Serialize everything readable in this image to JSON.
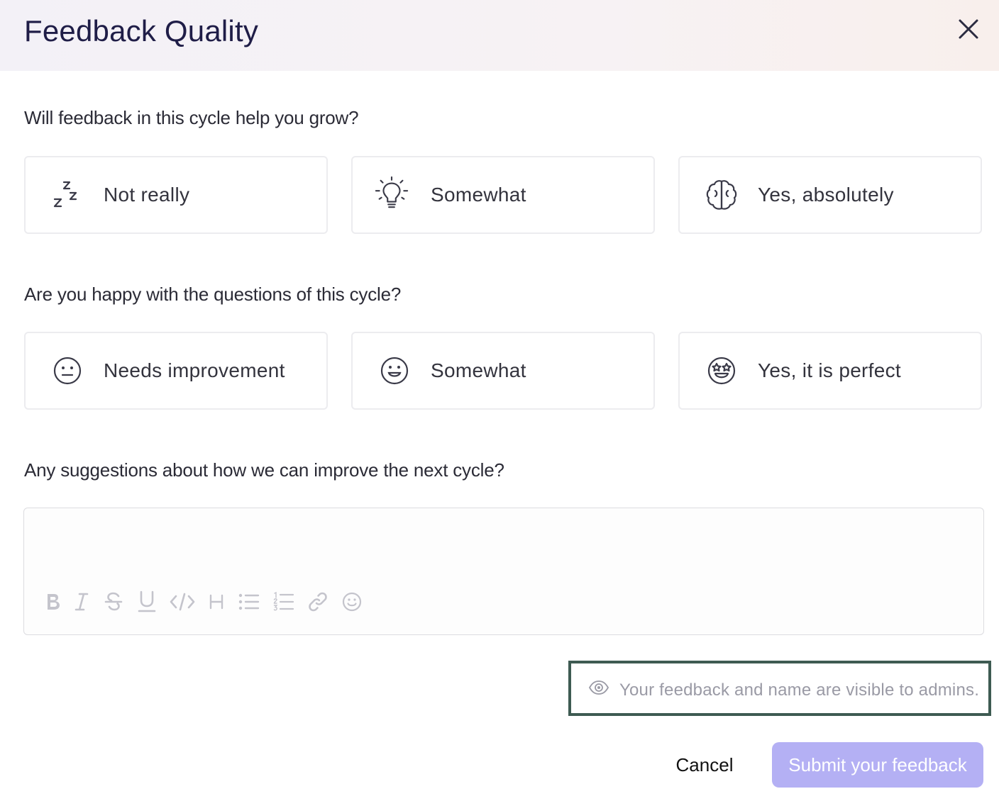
{
  "dialog": {
    "title": "Feedback Quality",
    "close_icon": "close-icon"
  },
  "q1": {
    "question": "Will feedback in this cycle help you grow?",
    "options": [
      {
        "label": "Not really",
        "icon": "sleep-zzz-icon"
      },
      {
        "label": "Somewhat",
        "icon": "lightbulb-icon"
      },
      {
        "label": "Yes, absolutely",
        "icon": "brain-icon"
      }
    ]
  },
  "q2": {
    "question": "Are you happy with the questions of this cycle?",
    "options": [
      {
        "label": "Needs improvement",
        "icon": "neutral-face-icon"
      },
      {
        "label": "Somewhat",
        "icon": "smiling-face-icon"
      },
      {
        "label": "Yes, it is perfect",
        "icon": "star-struck-face-icon"
      }
    ]
  },
  "q3": {
    "question": "Any suggestions about how we can improve the next cycle?",
    "value": "",
    "toolbar": [
      "bold-icon",
      "italic-icon",
      "strikethrough-icon",
      "underline-icon",
      "code-icon",
      "heading-icon",
      "bullet-list-icon",
      "numbered-list-icon",
      "link-icon",
      "emoji-icon"
    ]
  },
  "visibility_note": {
    "text": "Your feedback and name are visible to admins.",
    "icon": "eye-icon"
  },
  "actions": {
    "cancel_label": "Cancel",
    "submit_label": "Submit your feedback"
  },
  "colors": {
    "title": "#1f1d47",
    "submit_bg": "#b4b0f4",
    "highlight_border": "#3e5b52"
  }
}
